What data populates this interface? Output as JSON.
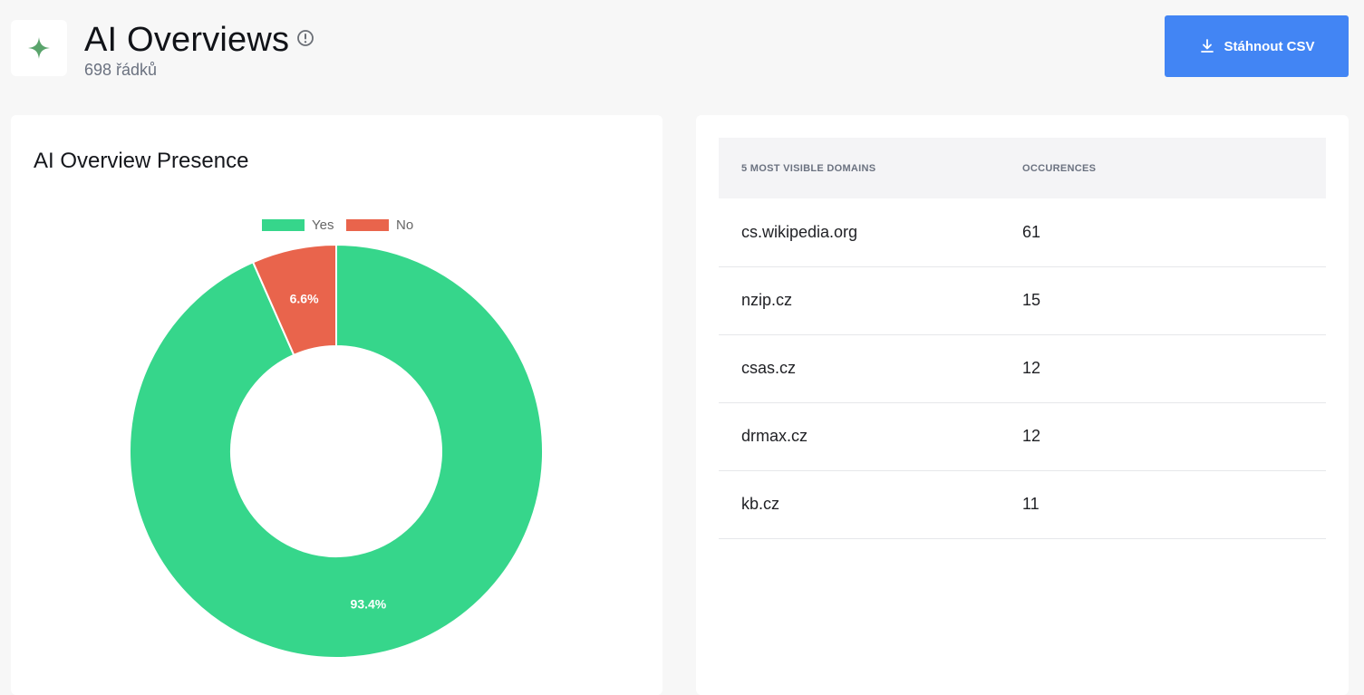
{
  "header": {
    "title": "AI Overviews",
    "row_count": "698 řádků",
    "download_label": "Stáhnout CSV"
  },
  "presence_card": {
    "title": "AI Overview Presence"
  },
  "chart_data": {
    "type": "pie",
    "title": "AI Overview Presence",
    "categories": [
      "Yes",
      "No"
    ],
    "values": [
      93.4,
      6.6
    ],
    "labels": [
      "93.4%",
      "6.6%"
    ],
    "colors": [
      "#36d68b",
      "#e9644c"
    ],
    "donut": true,
    "legend": "top"
  },
  "domains_table": {
    "headers": {
      "domain": "5 MOST VISIBLE DOMAINS",
      "occurrences": "OCCURENCES"
    },
    "rows": [
      {
        "domain": "cs.wikipedia.org",
        "count": "61"
      },
      {
        "domain": "nzip.cz",
        "count": "15"
      },
      {
        "domain": "csas.cz",
        "count": "12"
      },
      {
        "domain": "drmax.cz",
        "count": "12"
      },
      {
        "domain": "kb.cz",
        "count": "11"
      }
    ]
  },
  "colors": {
    "accent": "#4285f4",
    "yes": "#36d68b",
    "no": "#e9644c",
    "logo": "#5aa46c"
  },
  "icons": [
    "sparkle-icon",
    "info-icon",
    "download-icon"
  ]
}
